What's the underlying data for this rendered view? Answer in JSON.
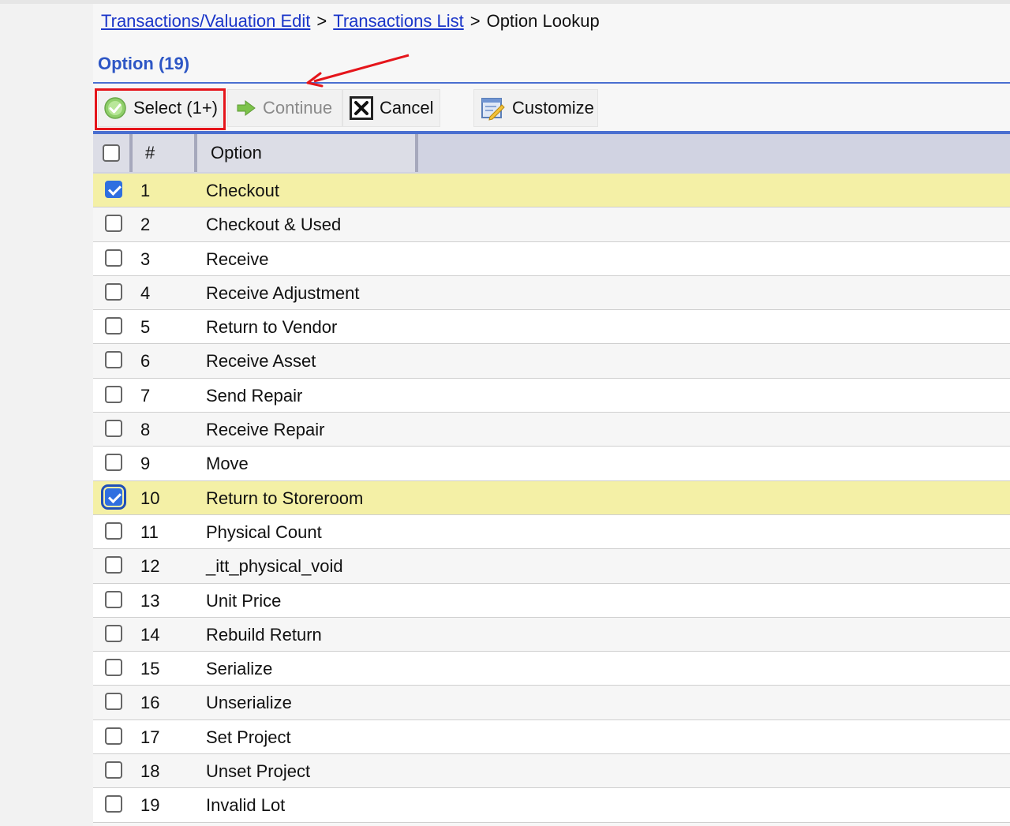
{
  "breadcrumb": {
    "links": [
      "Transactions/Valuation Edit",
      "Transactions List"
    ],
    "separator": ">",
    "current": "Option Lookup"
  },
  "page": {
    "title": "Option (19)"
  },
  "toolbar": {
    "select_label": "Select (1+)",
    "continue_label": "Continue",
    "cancel_label": "Cancel",
    "customize_label": "Customize"
  },
  "table": {
    "columns": [
      "#",
      "Option"
    ],
    "rows": [
      {
        "num": "1",
        "option": "Checkout",
        "checked": true
      },
      {
        "num": "2",
        "option": "Checkout & Used",
        "checked": false
      },
      {
        "num": "3",
        "option": "Receive",
        "checked": false
      },
      {
        "num": "4",
        "option": "Receive Adjustment",
        "checked": false
      },
      {
        "num": "5",
        "option": "Return to Vendor",
        "checked": false
      },
      {
        "num": "6",
        "option": "Receive Asset",
        "checked": false
      },
      {
        "num": "7",
        "option": "Send Repair",
        "checked": false
      },
      {
        "num": "8",
        "option": "Receive Repair",
        "checked": false
      },
      {
        "num": "9",
        "option": "Move",
        "checked": false
      },
      {
        "num": "10",
        "option": "Return to Storeroom",
        "checked": true
      },
      {
        "num": "11",
        "option": "Physical Count",
        "checked": false
      },
      {
        "num": "12",
        "option": "_itt_physical_void",
        "checked": false
      },
      {
        "num": "13",
        "option": "Unit Price",
        "checked": false
      },
      {
        "num": "14",
        "option": "Rebuild Return",
        "checked": false
      },
      {
        "num": "15",
        "option": "Serialize",
        "checked": false
      },
      {
        "num": "16",
        "option": "Unserialize",
        "checked": false
      },
      {
        "num": "17",
        "option": "Set Project",
        "checked": false
      },
      {
        "num": "18",
        "option": "Unset Project",
        "checked": false
      },
      {
        "num": "19",
        "option": "Invalid Lot",
        "checked": false
      }
    ]
  },
  "colors": {
    "link": "#1a35c9",
    "title": "#2d56c5",
    "rule": "#4a6fd0",
    "selected_row": "#f4f0a6",
    "checkbox_checked": "#2f6fe0",
    "highlight": "#e5151b"
  }
}
